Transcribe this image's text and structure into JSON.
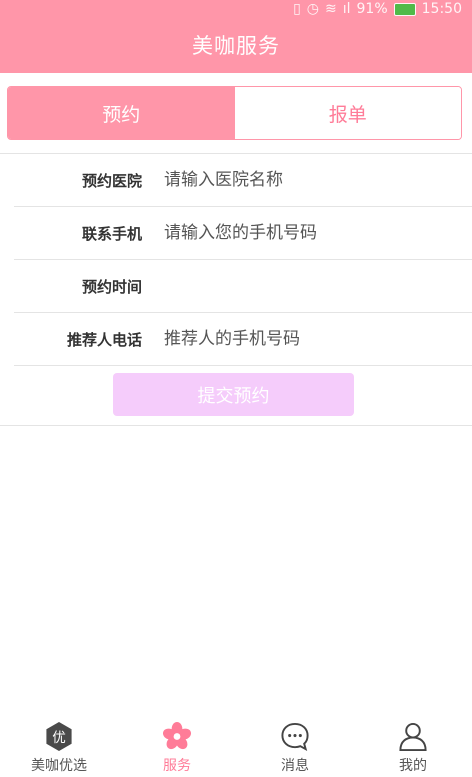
{
  "status_bar": {
    "battery": "91%",
    "time": "15:50"
  },
  "header": {
    "title": "美咖服务"
  },
  "segments": [
    {
      "label": "预约",
      "active": true
    },
    {
      "label": "报单",
      "active": false
    }
  ],
  "form": {
    "hospital": {
      "label": "预约医院",
      "placeholder": "请输入医院名称"
    },
    "phone": {
      "label": "联系手机",
      "placeholder": "请输入您的手机号码"
    },
    "time": {
      "label": "预约时间",
      "value": ""
    },
    "referrer": {
      "label": "推荐人电话",
      "placeholder": "推荐人的手机号码"
    }
  },
  "submit": {
    "label": "提交预约"
  },
  "tabbar": {
    "items": [
      {
        "label": "美咖优选",
        "icon": "hexagon-you-icon",
        "icon_text": "优"
      },
      {
        "label": "服务",
        "icon": "flower-icon",
        "active": true
      },
      {
        "label": "消息",
        "icon": "chat-bubble-icon"
      },
      {
        "label": "我的",
        "icon": "user-icon"
      }
    ]
  },
  "colors": {
    "brand": "#ff96a9",
    "accent_text": "#ff7c98",
    "submit_disabled": "#f5ccfb"
  }
}
